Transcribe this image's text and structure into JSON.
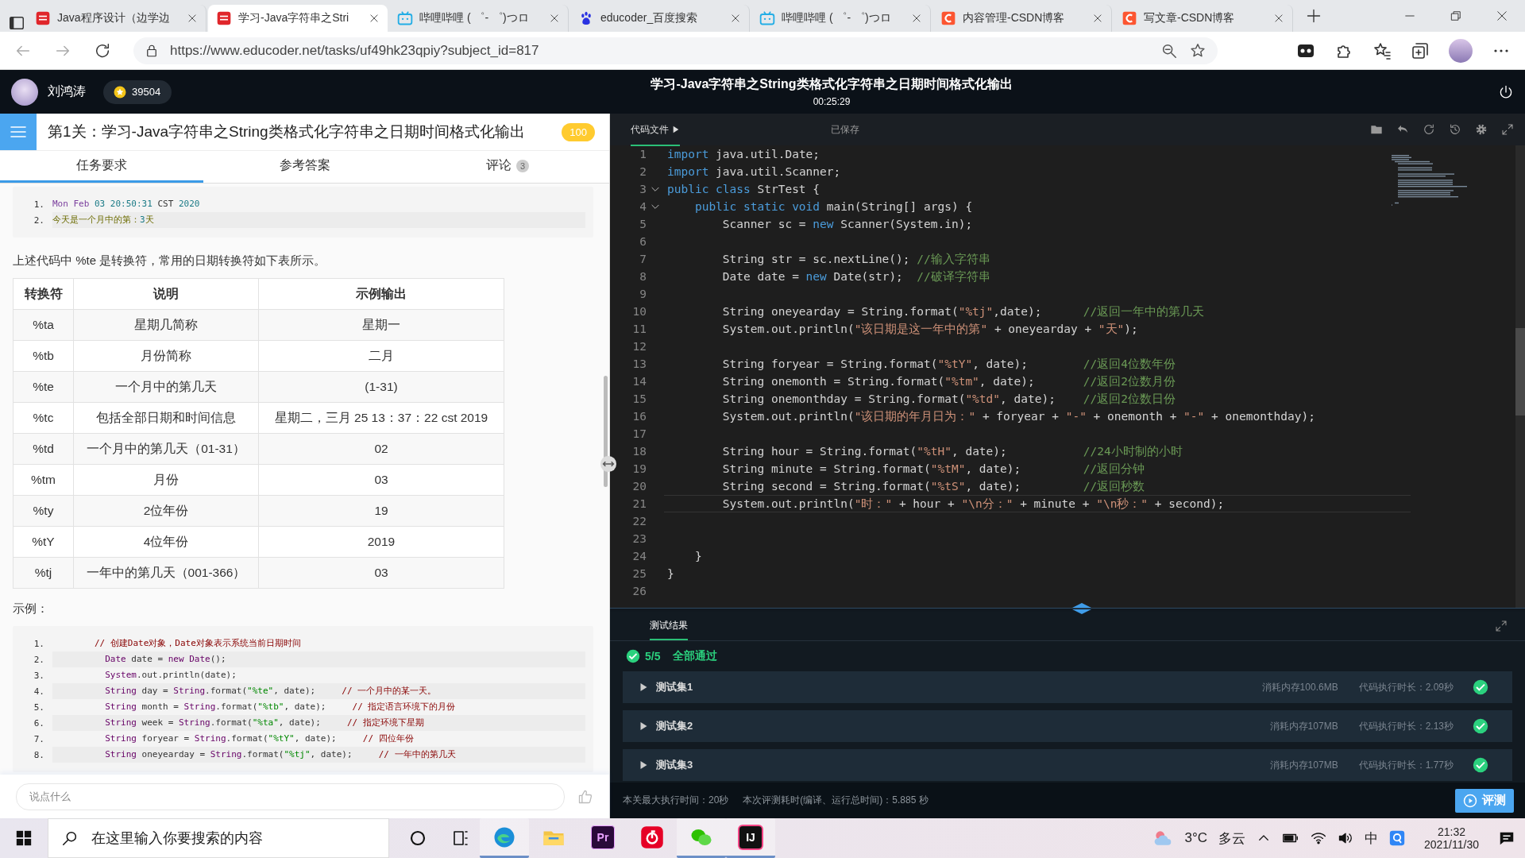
{
  "browser": {
    "tabs": [
      {
        "title": "Java程序设计（边学边",
        "kind": "toutiao",
        "selected": false
      },
      {
        "title": "学习-Java字符串之Stri",
        "kind": "toutiao",
        "selected": true
      },
      {
        "title": "哔哩哔哩 ( ゜- ゜)つロ",
        "kind": "bili",
        "selected": false
      },
      {
        "title": "educoder_百度搜索",
        "kind": "baidu",
        "selected": false
      },
      {
        "title": "哔哩哔哩 ( ゜- ゜)つロ",
        "kind": "bili",
        "selected": false
      },
      {
        "title": "内容管理-CSDN博客",
        "kind": "csdn",
        "selected": false
      },
      {
        "title": "写文章-CSDN博客",
        "kind": "csdn",
        "selected": false
      }
    ],
    "url": "https://www.educoder.net/tasks/uf49hk23qpiy?subject_id=817"
  },
  "header": {
    "user": "刘鸿涛",
    "coins": "39504",
    "title": "学习-Java字符串之String类格式化字符串之日期时间格式化输出",
    "timer": "00:25:29"
  },
  "task": {
    "title": "第1关：学习-Java字符串之String类格式化字符串之日期时间格式化输出",
    "score": "100",
    "tabs": [
      {
        "label": "任务要求",
        "selected": true
      },
      {
        "label": "参考答案",
        "selected": false
      },
      {
        "label": "评论",
        "selected": false,
        "count": "3"
      }
    ]
  },
  "content": {
    "output_lines": [
      {
        "n": "1.",
        "segs": [
          {
            "kind": "v",
            "text": "Mon Feb "
          },
          {
            "kind": "d",
            "text": "03 20:50:31"
          },
          {
            "kind": "p",
            "text": " CST "
          },
          {
            "kind": "d",
            "text": "2020"
          }
        ]
      },
      {
        "n": "2.",
        "segs": [
          {
            "kind": "o",
            "text": "今天是一个月中的第："
          },
          {
            "kind": "d",
            "text": "3"
          },
          {
            "kind": "o",
            "text": "天"
          }
        ]
      }
    ],
    "intro": "上述代码中 %te 是转换符，常用的日期转换符如下表所示。",
    "table": {
      "columns": [
        "转换符",
        "说明",
        "示例输出"
      ],
      "rows": [
        [
          "%ta",
          "星期几简称",
          "星期一"
        ],
        [
          "%tb",
          "月份简称",
          "二月"
        ],
        [
          "%te",
          "一个月中的第几天",
          "(1-31)"
        ],
        [
          "%tc",
          "包括全部日期和时间信息",
          "星期二，三月 25 13：37：22 cst 2019"
        ],
        [
          "%td",
          "一个月中的第几天（01-31）",
          "02"
        ],
        [
          "%tm",
          "月份",
          "03"
        ],
        [
          "%ty",
          "2位年份",
          "19"
        ],
        [
          "%tY",
          "4位年份",
          "2019"
        ],
        [
          "%tj",
          "一年中的第几天（001-366）",
          "03"
        ]
      ]
    },
    "example_label": "示例：",
    "example_lines": [
      {
        "n": "1.",
        "segs": [
          {
            "kind": "c",
            "text": "        // 创建Date对象，Date对象表示系统当前日期时间"
          }
        ]
      },
      {
        "n": "2.",
        "segs": [
          {
            "kind": "t",
            "text": "          Date"
          },
          {
            "kind": "p",
            "text": " date = "
          },
          {
            "kind": "t",
            "text": "new Date"
          },
          {
            "kind": "p",
            "text": "();"
          }
        ]
      },
      {
        "n": "3.",
        "segs": [
          {
            "kind": "t",
            "text": "          System"
          },
          {
            "kind": "p",
            "text": ".out.println(date);"
          }
        ]
      },
      {
        "n": "4.",
        "segs": [
          {
            "kind": "t",
            "text": "          String"
          },
          {
            "kind": "p",
            "text": " day = "
          },
          {
            "kind": "t",
            "text": "String"
          },
          {
            "kind": "p",
            "text": ".format("
          },
          {
            "kind": "s",
            "text": "\"%te\""
          },
          {
            "kind": "p",
            "text": ", date);     "
          },
          {
            "kind": "c",
            "text": "// 一个月中的某一天。"
          }
        ]
      },
      {
        "n": "5.",
        "segs": [
          {
            "kind": "t",
            "text": "          String"
          },
          {
            "kind": "p",
            "text": " month = "
          },
          {
            "kind": "t",
            "text": "String"
          },
          {
            "kind": "p",
            "text": ".format("
          },
          {
            "kind": "s",
            "text": "\"%tb\""
          },
          {
            "kind": "p",
            "text": ", date);     "
          },
          {
            "kind": "c",
            "text": "// 指定语言环境下的月份"
          }
        ]
      },
      {
        "n": "6.",
        "segs": [
          {
            "kind": "t",
            "text": "          String"
          },
          {
            "kind": "p",
            "text": " week = "
          },
          {
            "kind": "t",
            "text": "String"
          },
          {
            "kind": "p",
            "text": ".format("
          },
          {
            "kind": "s",
            "text": "\"%ta\""
          },
          {
            "kind": "p",
            "text": ", date);     "
          },
          {
            "kind": "c",
            "text": "// 指定环境下星期"
          }
        ]
      },
      {
        "n": "7.",
        "segs": [
          {
            "kind": "t",
            "text": "          String"
          },
          {
            "kind": "p",
            "text": " foryear = "
          },
          {
            "kind": "t",
            "text": "String"
          },
          {
            "kind": "p",
            "text": ".format("
          },
          {
            "kind": "s",
            "text": "\"%tY\""
          },
          {
            "kind": "p",
            "text": ", date);     "
          },
          {
            "kind": "c",
            "text": "// 四位年份"
          }
        ]
      },
      {
        "n": "8.",
        "segs": [
          {
            "kind": "t",
            "text": "          String"
          },
          {
            "kind": "p",
            "text": " oneyearday = "
          },
          {
            "kind": "t",
            "text": "String"
          },
          {
            "kind": "p",
            "text": ".format("
          },
          {
            "kind": "s",
            "text": "\"%tj\""
          },
          {
            "kind": "p",
            "text": ", date);     "
          },
          {
            "kind": "c",
            "text": "// 一年中的第几天"
          }
        ]
      }
    ]
  },
  "comment": {
    "placeholder": "说点什么"
  },
  "editor": {
    "file_label": "代码文件",
    "status": "已保存",
    "lines": [
      {
        "n": "1",
        "fold": false,
        "current": false,
        "segs": [
          {
            "kind": "k",
            "text": "import"
          },
          {
            "kind": "p",
            "text": " java.util.Date;"
          }
        ]
      },
      {
        "n": "2",
        "fold": false,
        "current": false,
        "segs": [
          {
            "kind": "k",
            "text": "import"
          },
          {
            "kind": "p",
            "text": " java.util.Scanner;"
          }
        ]
      },
      {
        "n": "3",
        "fold": true,
        "current": false,
        "segs": [
          {
            "kind": "k",
            "text": "public class"
          },
          {
            "kind": "p",
            "text": " StrTest {"
          }
        ]
      },
      {
        "n": "4",
        "fold": true,
        "current": false,
        "segs": [
          {
            "kind": "k",
            "text": "    public static void"
          },
          {
            "kind": "p",
            "text": " main(String[] args) {"
          }
        ]
      },
      {
        "n": "5",
        "fold": false,
        "current": false,
        "segs": [
          {
            "kind": "p",
            "text": "        Scanner sc = "
          },
          {
            "kind": "k",
            "text": "new"
          },
          {
            "kind": "p",
            "text": " Scanner(System.in);"
          }
        ]
      },
      {
        "n": "6",
        "fold": false,
        "current": false
      },
      {
        "n": "7",
        "fold": false,
        "current": false,
        "segs": [
          {
            "kind": "p",
            "text": "        String str = sc.nextLine(); "
          },
          {
            "kind": "c",
            "text": "//输入字符串"
          }
        ]
      },
      {
        "n": "8",
        "fold": false,
        "current": false,
        "segs": [
          {
            "kind": "p",
            "text": "        Date date = "
          },
          {
            "kind": "k",
            "text": "new"
          },
          {
            "kind": "p",
            "text": " Date(str);  "
          },
          {
            "kind": "c",
            "text": "//破译字符串"
          }
        ]
      },
      {
        "n": "9",
        "fold": false,
        "current": false
      },
      {
        "n": "10",
        "fold": false,
        "current": false,
        "segs": [
          {
            "kind": "p",
            "text": "        String oneyearday = String.format("
          },
          {
            "kind": "s",
            "text": "\"%tj\""
          },
          {
            "kind": "p",
            "text": ",date);      "
          },
          {
            "kind": "c",
            "text": "//返回一年中的第几天"
          }
        ]
      },
      {
        "n": "11",
        "fold": false,
        "current": false,
        "segs": [
          {
            "kind": "p",
            "text": "        System.out.println("
          },
          {
            "kind": "s",
            "text": "\"该日期是这一年中的第\""
          },
          {
            "kind": "p",
            "text": " + oneyearday + "
          },
          {
            "kind": "s",
            "text": "\"天\""
          },
          {
            "kind": "p",
            "text": ");"
          }
        ]
      },
      {
        "n": "12",
        "fold": false,
        "current": false
      },
      {
        "n": "13",
        "fold": false,
        "current": false,
        "segs": [
          {
            "kind": "p",
            "text": "        String foryear = String.format("
          },
          {
            "kind": "s",
            "text": "\"%tY\""
          },
          {
            "kind": "p",
            "text": ", date);        "
          },
          {
            "kind": "c",
            "text": "//返回4位数年份"
          }
        ]
      },
      {
        "n": "14",
        "fold": false,
        "current": false,
        "segs": [
          {
            "kind": "p",
            "text": "        String onemonth = String.format("
          },
          {
            "kind": "s",
            "text": "\"%tm\""
          },
          {
            "kind": "p",
            "text": ", date);       "
          },
          {
            "kind": "c",
            "text": "//返回2位数月份"
          }
        ]
      },
      {
        "n": "15",
        "fold": false,
        "current": false,
        "segs": [
          {
            "kind": "p",
            "text": "        String onemonthday = String.format("
          },
          {
            "kind": "s",
            "text": "\"%td\""
          },
          {
            "kind": "p",
            "text": ", date);    "
          },
          {
            "kind": "c",
            "text": "//返回2位数日份"
          }
        ]
      },
      {
        "n": "16",
        "fold": false,
        "current": false,
        "segs": [
          {
            "kind": "p",
            "text": "        System.out.println("
          },
          {
            "kind": "s",
            "text": "\"该日期的年月日为：\""
          },
          {
            "kind": "p",
            "text": " + foryear + "
          },
          {
            "kind": "s",
            "text": "\"-\""
          },
          {
            "kind": "p",
            "text": " + onemonth + "
          },
          {
            "kind": "s",
            "text": "\"-\""
          },
          {
            "kind": "p",
            "text": " + onemonthday);"
          }
        ]
      },
      {
        "n": "17",
        "fold": false,
        "current": false
      },
      {
        "n": "18",
        "fold": false,
        "current": false,
        "segs": [
          {
            "kind": "p",
            "text": "        String hour = String.format("
          },
          {
            "kind": "s",
            "text": "\"%tH\""
          },
          {
            "kind": "p",
            "text": ", date);           "
          },
          {
            "kind": "c",
            "text": "//24小时制的小时"
          }
        ]
      },
      {
        "n": "19",
        "fold": false,
        "current": false,
        "segs": [
          {
            "kind": "p",
            "text": "        String minute = String.format("
          },
          {
            "kind": "s",
            "text": "\"%tM\""
          },
          {
            "kind": "p",
            "text": ", date);         "
          },
          {
            "kind": "c",
            "text": "//返回分钟"
          }
        ]
      },
      {
        "n": "20",
        "fold": false,
        "current": false,
        "segs": [
          {
            "kind": "p",
            "text": "        String second = String.format("
          },
          {
            "kind": "s",
            "text": "\"%tS\""
          },
          {
            "kind": "p",
            "text": ", date);         "
          },
          {
            "kind": "c",
            "text": "//返回秒数"
          }
        ]
      },
      {
        "n": "21",
        "fold": false,
        "current": true,
        "segs": [
          {
            "kind": "p",
            "text": "        System.out.println("
          },
          {
            "kind": "s",
            "text": "\"时：\""
          },
          {
            "kind": "p",
            "text": " + hour + "
          },
          {
            "kind": "s",
            "text": "\"\\n分：\""
          },
          {
            "kind": "p",
            "text": " + minute + "
          },
          {
            "kind": "s",
            "text": "\"\\n秒：\""
          },
          {
            "kind": "p",
            "text": " + second);"
          }
        ]
      },
      {
        "n": "22",
        "fold": false,
        "current": false
      },
      {
        "n": "23",
        "fold": false,
        "current": false
      },
      {
        "n": "24",
        "fold": false,
        "current": false,
        "segs": [
          {
            "kind": "p",
            "text": "    }"
          }
        ]
      },
      {
        "n": "25",
        "fold": false,
        "current": false,
        "segs": [
          {
            "kind": "p",
            "text": "}"
          }
        ]
      },
      {
        "n": "26",
        "fold": false,
        "current": false
      }
    ]
  },
  "tests": {
    "tabs": [
      {
        "label": "测试结果",
        "selected": true
      }
    ],
    "passed": "5/5",
    "summary": "全部通过",
    "sets": [
      {
        "name": "测试集1",
        "memory": "消耗内存100.6MB",
        "time": "代码执行时长：2.09秒",
        "passed": true
      },
      {
        "name": "测试集2",
        "memory": "消耗内存107MB",
        "time": "代码执行时长：2.13秒",
        "passed": true
      },
      {
        "name": "测试集3",
        "memory": "消耗内存107MB",
        "time": "代码执行时长：1.77秒",
        "passed": true
      }
    ],
    "max_time": "本关最大执行时间：20秒",
    "elapsed": "本次评测耗时(编译、运行总时间)：5.885 秒",
    "run_button": "评测"
  },
  "taskbar": {
    "search_placeholder": "在这里输入你要搜索的内容",
    "apps": [
      {
        "kind": "edge",
        "running": true
      },
      {
        "kind": "explorer",
        "running": false
      },
      {
        "kind": "premiere",
        "label": "Pr",
        "running": false
      },
      {
        "kind": "netease",
        "running": false
      },
      {
        "kind": "wechat",
        "running": true
      },
      {
        "kind": "intellij",
        "label": "IJ",
        "running": true
      }
    ],
    "temp": "3°C",
    "sky": "多云",
    "ime": "中",
    "time": "21:32",
    "date": "2021/11/30"
  }
}
